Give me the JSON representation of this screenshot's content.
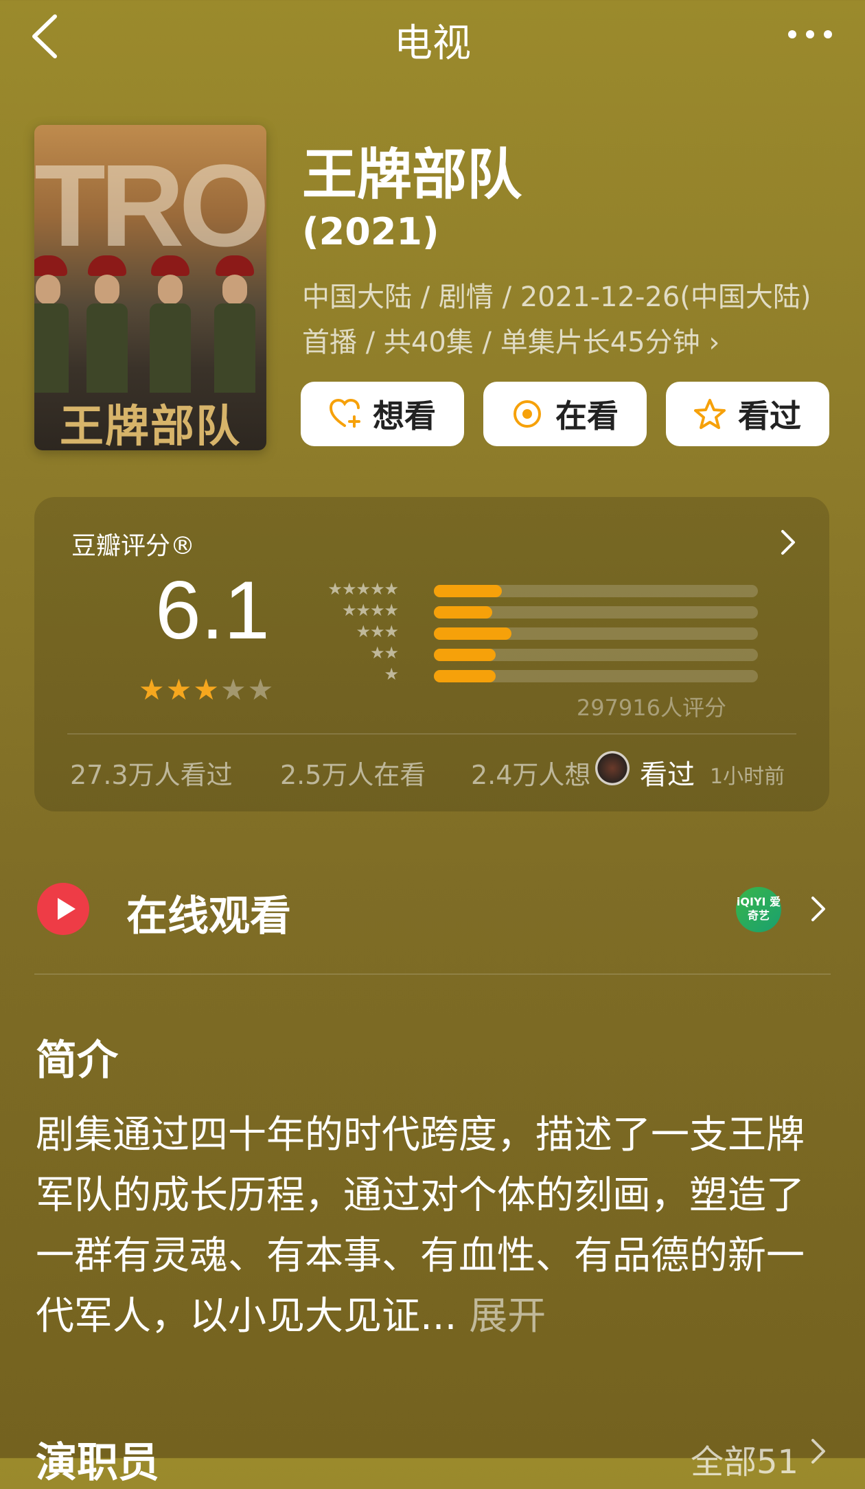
{
  "header": {
    "title": "电视"
  },
  "poster": {
    "big_text": "TROO",
    "title_text": "王牌部队"
  },
  "show": {
    "title": "王牌部队",
    "year": "(2021)",
    "meta": "中国大陆 / 剧情 / 2021-12-26(中国大陆)首播 / 共40集 / 单集片长45分钟 ›"
  },
  "actions": {
    "want": "想看",
    "watching": "在看",
    "watched": "看过"
  },
  "rating": {
    "label": "豆瓣评分®",
    "score": "6.1",
    "stars_filled": 3,
    "stars_total": 5,
    "distribution": [
      {
        "stars": "★★★★★",
        "fraction": 0.21
      },
      {
        "stars": "★★★★",
        "fraction": 0.18
      },
      {
        "stars": "★★★",
        "fraction": 0.24
      },
      {
        "stars": "★★",
        "fraction": 0.19
      },
      {
        "stars": "★",
        "fraction": 0.19
      }
    ],
    "count": "297916人评分",
    "stats": {
      "watched": "27.3万人看过",
      "watching": "2.5万人在看",
      "want": "2.4万人想"
    },
    "friend": {
      "action": "看过",
      "time": "1小时前"
    }
  },
  "online": {
    "label": "在线观看",
    "provider": "iQIYI 爱奇艺"
  },
  "intro": {
    "heading": "简介",
    "text": "剧集通过四十年的时代跨度，描述了一支王牌军队的成长历程，通过对个体的刻画，塑造了一群有灵魂、有本事、有血性、有品德的新一代军人，以小见大见证...",
    "expand": "展开"
  },
  "cast": {
    "heading": "演职员",
    "all": "全部51"
  },
  "colors": {
    "accent": "#f6a10a",
    "play": "#ee3c46"
  }
}
